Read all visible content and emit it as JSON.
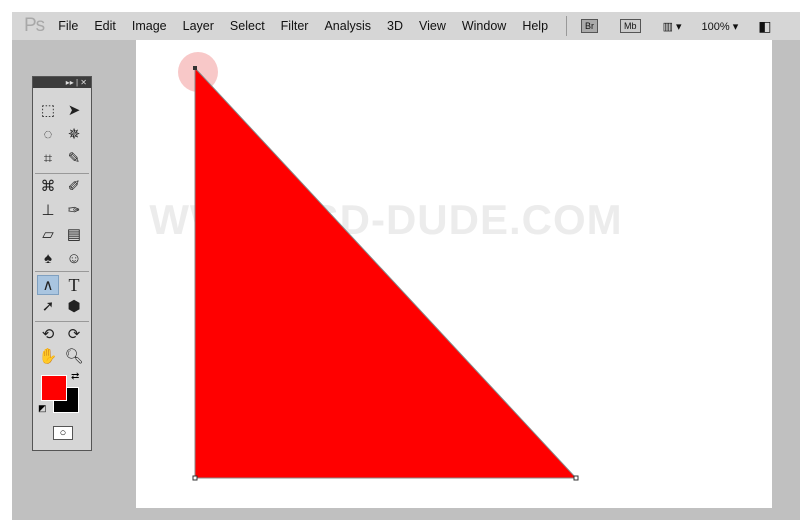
{
  "app": {
    "logo": "Ps",
    "menu": [
      "File",
      "Edit",
      "Image",
      "Layer",
      "Select",
      "Filter",
      "Analysis",
      "3D",
      "View",
      "Window",
      "Help"
    ],
    "bridge": "Br",
    "mini_bridge": "Mb",
    "zoom": "100%"
  },
  "canvas": {
    "watermark": "WWW.PSD-DUDE.COM",
    "shape_color": "#ff0000",
    "foreground_color": "#ff0000",
    "background_color": "#000000"
  },
  "toolbox": {
    "header": "▸▸ | ✕",
    "active_tool": "pen-tool"
  }
}
